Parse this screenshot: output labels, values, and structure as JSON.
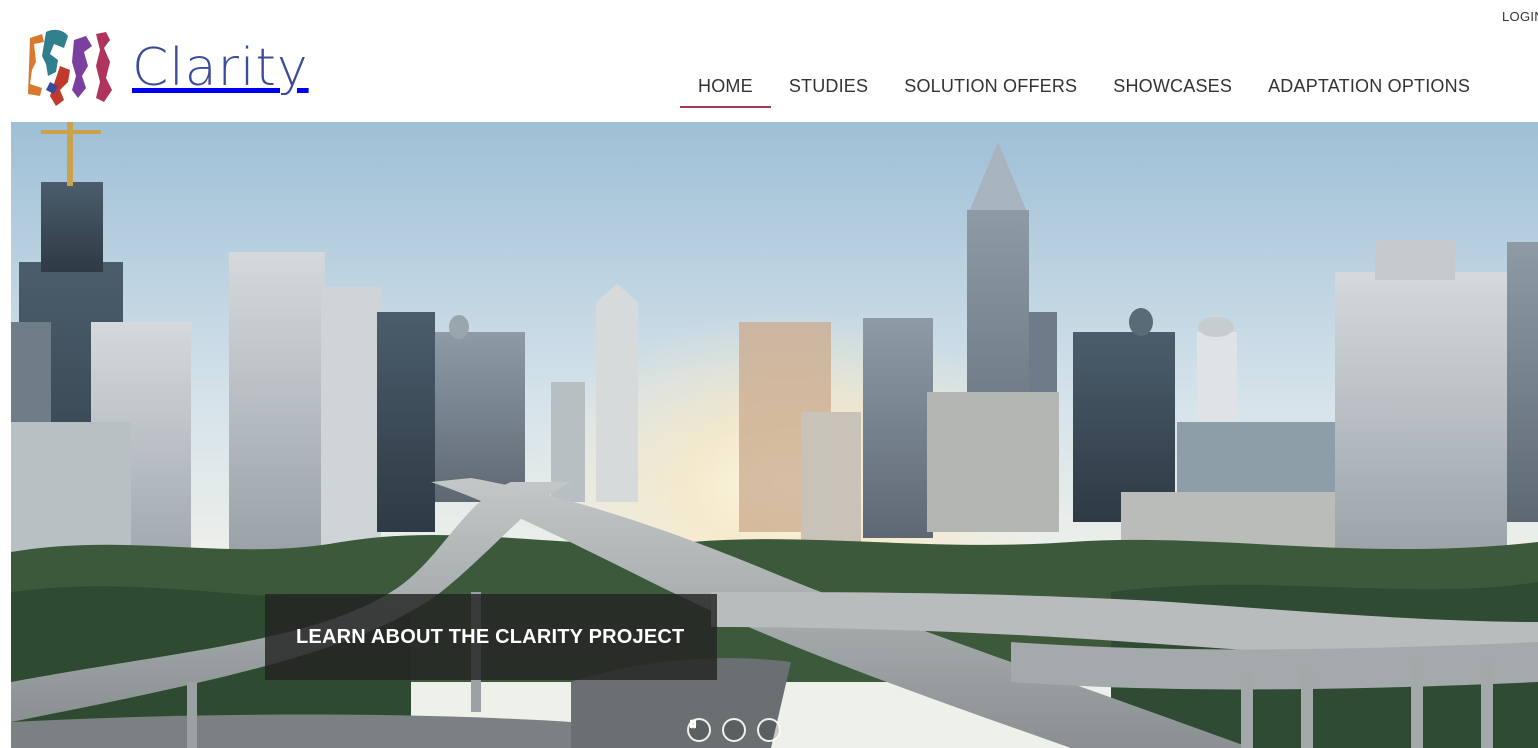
{
  "header": {
    "login_label": "LOGIN",
    "logo_text": "Clarity",
    "nav": [
      {
        "label": "HOME",
        "active": true
      },
      {
        "label": "STUDIES",
        "active": false
      },
      {
        "label": "SOLUTION OFFERS",
        "active": false
      },
      {
        "label": "SHOWCASES",
        "active": false
      },
      {
        "label": "ADAPTATION OPTIONS",
        "active": false
      }
    ]
  },
  "hero": {
    "caption": "LEARN ABOUT THE CLARITY PROJECT",
    "controls": [
      {
        "icon": "chevron-left-icon"
      },
      {
        "icon": "pause-icon"
      },
      {
        "icon": "chevron-right-icon"
      }
    ]
  },
  "colors": {
    "accent": "#a53a55",
    "logo_text": "#3b4a9a",
    "nav_text": "#333333"
  }
}
